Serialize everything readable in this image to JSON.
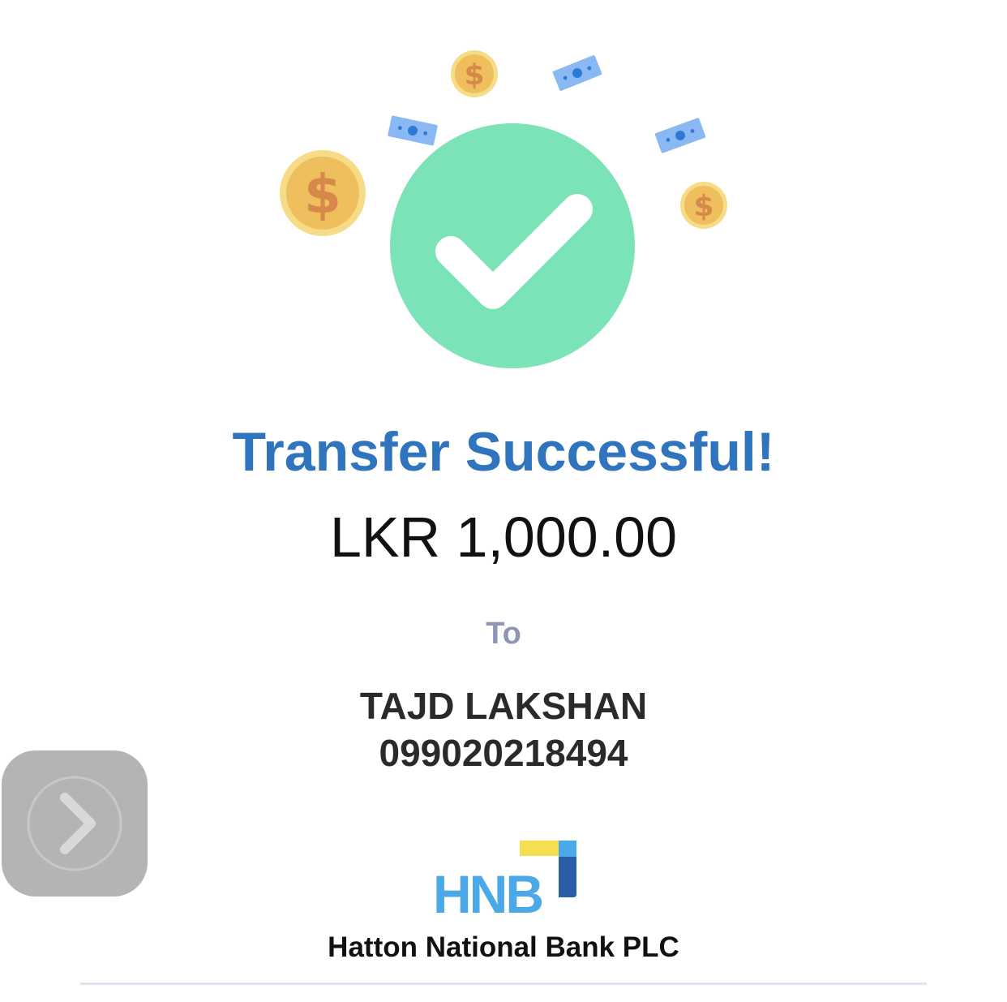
{
  "receipt": {
    "title": "Transfer Successful!",
    "amount": "LKR 1,000.00",
    "to_label": "To",
    "payee_name": "TAJD LAKSHAN",
    "payee_account": "099020218494"
  },
  "bank": {
    "logo_text": "HNB",
    "name": "Hatton National Bank PLC"
  },
  "icons": {
    "success": "check-circle-icon",
    "coin": "dollar-coin-icon",
    "banknote": "banknote-icon",
    "assistive_touch": "chevron-right-icon"
  },
  "colors": {
    "title": "#2f74bd",
    "success_circle": "#7ce2b7",
    "coin": "#f1c66a",
    "banknote": "#8ab8f2",
    "hnb_blue": "#4aa9e6",
    "hnb_yellow": "#f6de52",
    "hnb_dark_blue": "#2b5ea9",
    "to_label": "#8f96b3"
  }
}
